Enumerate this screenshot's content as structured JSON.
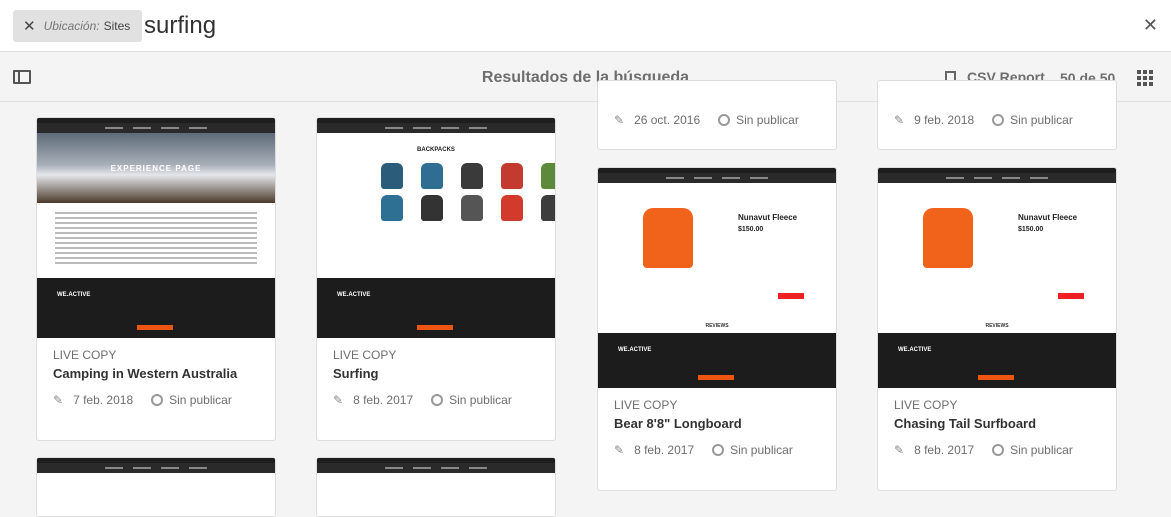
{
  "search": {
    "tag_key": "Ubicación:",
    "tag_value": "Sites",
    "query": "surfing"
  },
  "toolbar": {
    "title": "Resultados de la búsqueda",
    "csv_label": "CSV Report",
    "count": "50 de 50"
  },
  "cards": [
    {
      "type": "LIVE COPY",
      "name": "Camping in Western Australia",
      "date": "7 feb. 2018",
      "status": "Sin publicar",
      "hero": "EXPERIENCE PAGE"
    },
    {
      "type": "LIVE COPY",
      "name": "Surfing",
      "date": "8 feb. 2017",
      "status": "Sin publicar",
      "heading": "BACKPACKS"
    },
    {
      "type": "LIVE COPY",
      "name": "Bear 8'8\" Longboard",
      "date": "8 feb. 2017",
      "status": "Sin publicar",
      "product": "Nunavut Fleece",
      "price": "$150.00",
      "reviews": "REVIEWS"
    },
    {
      "type": "LIVE COPY",
      "name": "Chasing Tail Surfboard",
      "date": "8 feb. 2017",
      "status": "Sin publicar",
      "product": "Nunavut Fleece",
      "price": "$150.00",
      "reviews": "REVIEWS"
    },
    {
      "date": "26 oct. 2016",
      "status": "Sin publicar"
    },
    {
      "date": "9 feb. 2018",
      "status": "Sin publicar"
    }
  ],
  "colors": {
    "accent": "#e51e25",
    "product": "#f1621a"
  }
}
